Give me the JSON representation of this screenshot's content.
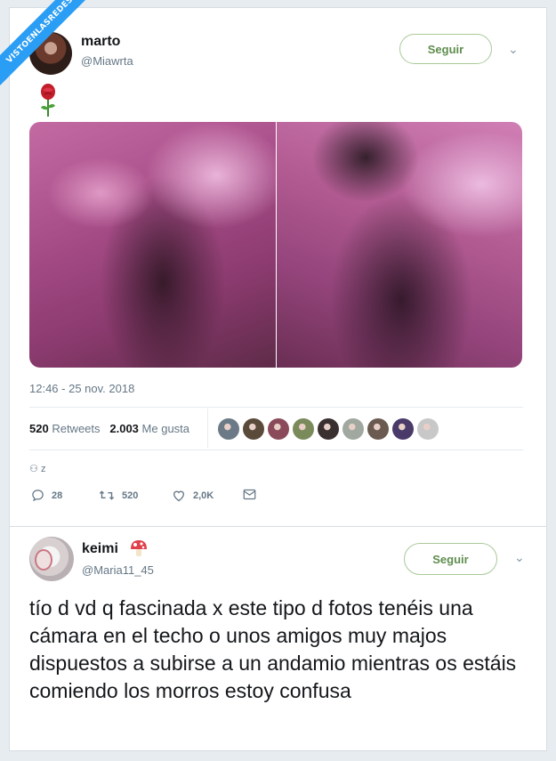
{
  "watermark": "VISTOENLASREDES",
  "tweet1": {
    "author_name": "marto",
    "author_handle": "@Miawrta",
    "follow_label": "Seguir",
    "text_emoji": "rose",
    "timestamp": "12:46 - 25 nov. 2018",
    "retweets_count": "520",
    "retweets_label": "Retweets",
    "likes_count": "2.003",
    "likes_label": "Me gusta",
    "liker_avatars": [
      "#6b7a86",
      "#5a4a3a",
      "#8b4a5a",
      "#7a8a5a",
      "#3a3030",
      "#a0a8a0",
      "#6a5a50",
      "#4a3a6a",
      "#c8c8c8"
    ],
    "quote_indicator": "z",
    "actions": {
      "reply_count": "28",
      "retweet_count": "520",
      "like_count": "2,0K"
    }
  },
  "tweet2": {
    "author_name": "keimi",
    "author_handle": "@Maria11_45",
    "follow_label": "Seguir",
    "text": "tío d vd q fascinada x este tipo d fotos tenéis una cámara en el techo o unos amigos muy majos dispuestos a subirse a un andamio mientras os estáis comiendo los morros estoy confusa"
  },
  "colors": {
    "follow_green": "#5f8d4e",
    "ribbon_blue": "#2a9df4",
    "secondary_text": "#657786"
  }
}
